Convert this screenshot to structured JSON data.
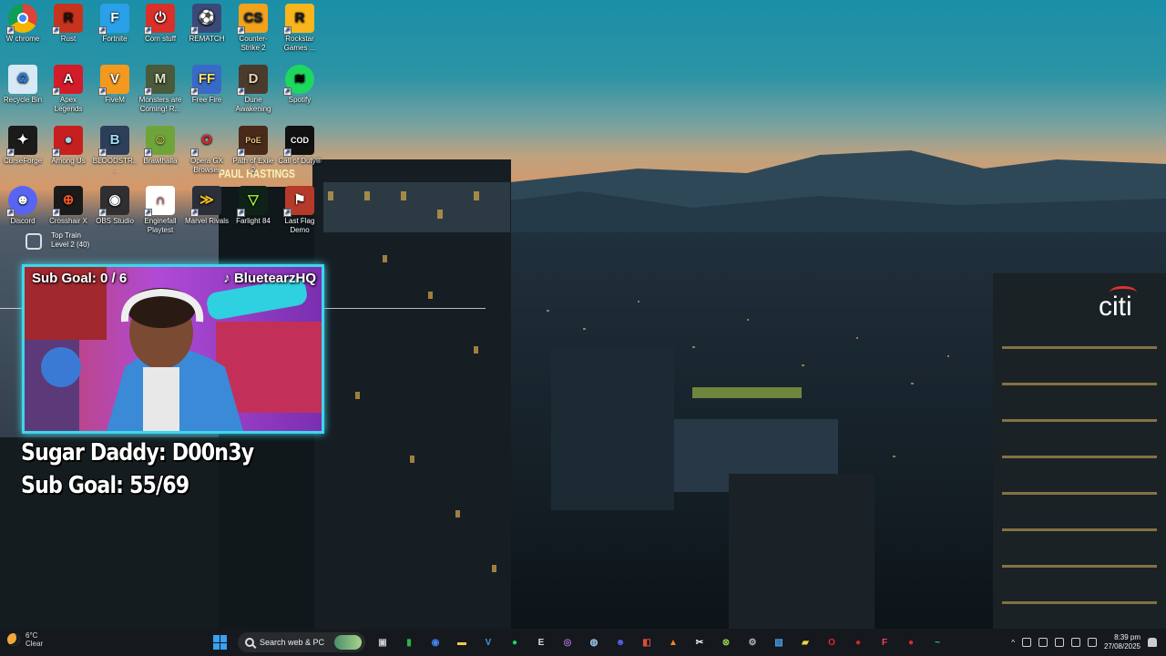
{
  "desktop": {
    "icons": [
      {
        "label": "W chrome",
        "icon": "chrome-icon",
        "glyph": "",
        "bg": "#ffffff",
        "fg": "#db4437"
      },
      {
        "label": "Rust",
        "icon": "rust-icon",
        "glyph": "R",
        "bg": "#c8331e",
        "fg": "#2b0d08"
      },
      {
        "label": "Fortnite",
        "icon": "fortnite-icon",
        "glyph": "F",
        "bg": "#2aa0e8",
        "fg": "#ffffff"
      },
      {
        "label": "Com stuff",
        "icon": "power-icon",
        "glyph": "⏻",
        "bg": "#d9302a",
        "fg": "#ffffff"
      },
      {
        "label": "REMATCH",
        "icon": "rematch-icon",
        "glyph": "⚽",
        "bg": "#3a4a78",
        "fg": "#ffffff"
      },
      {
        "label": "Counter-Strike 2",
        "icon": "counter-strike-icon",
        "glyph": "CS",
        "bg": "#f3a21c",
        "fg": "#1b2738"
      },
      {
        "label": "Rockstar Games ...",
        "icon": "rockstar-icon",
        "glyph": "R",
        "bg": "#f8b61c",
        "fg": "#1a1a1a"
      },
      {
        "label": "Recycle Bin",
        "icon": "recycle-bin-icon",
        "glyph": "♻",
        "bg": "#d7e9f5",
        "fg": "#2a7bd4"
      },
      {
        "label": "Apex Legends",
        "icon": "apex-icon",
        "glyph": "A",
        "bg": "#d21c2a",
        "fg": "#ffffff"
      },
      {
        "label": "FiveM",
        "icon": "fivem-icon",
        "glyph": "V",
        "bg": "#f39a1e",
        "fg": "#ffffff"
      },
      {
        "label": "Monsters are Coming! R...",
        "icon": "monsters-icon",
        "glyph": "M",
        "bg": "#4a5a3a",
        "fg": "#dfe3c0"
      },
      {
        "label": "Free Fire",
        "icon": "free-fire-icon",
        "glyph": "FF",
        "bg": "#3a6ac8",
        "fg": "#ffe16a"
      },
      {
        "label": "Dune Awakening",
        "icon": "dune-icon",
        "glyph": "D",
        "bg": "#4a3b2d",
        "fg": "#e8d6b5"
      },
      {
        "label": "Spotify",
        "icon": "spotify-icon",
        "glyph": "≋",
        "bg": "#1ed760",
        "fg": "#000000"
      },
      {
        "label": "CurseForge",
        "icon": "curseforge-icon",
        "glyph": "✦",
        "bg": "#1b1b1b",
        "fg": "#ffffff"
      },
      {
        "label": "Among Us",
        "icon": "among-us-icon",
        "glyph": "●",
        "bg": "#c71f1f",
        "fg": "#9fd7f2"
      },
      {
        "label": "BLOODSTR...",
        "icon": "bloodstrike-icon",
        "glyph": "B",
        "bg": "#2d3e5a",
        "fg": "#9fe0f5"
      },
      {
        "label": "Brawlhalla",
        "icon": "brawlhalla-icon",
        "glyph": "☺",
        "bg": "#6ea43a",
        "fg": "#ffe16a"
      },
      {
        "label": "Opera GX Browser",
        "icon": "opera-gx-icon",
        "glyph": "O",
        "bg": "transparent",
        "fg": "#e8242e"
      },
      {
        "label": "Path of Exile 2",
        "icon": "path-of-exile-icon",
        "glyph": "PoE",
        "bg": "#4a2a1a",
        "fg": "#e7c37a"
      },
      {
        "label": "Call of Duty®",
        "icon": "call-of-duty-icon",
        "glyph": "COD",
        "bg": "#111111",
        "fg": "#ffffff"
      },
      {
        "label": "Discord",
        "icon": "discord-icon",
        "glyph": "☻",
        "bg": "#5865f2",
        "fg": "#ffffff"
      },
      {
        "label": "Crosshair X",
        "icon": "crosshair-icon",
        "glyph": "⊕",
        "bg": "#1a1a1a",
        "fg": "#f0582a"
      },
      {
        "label": "OBS Studio",
        "icon": "obs-icon",
        "glyph": "◉",
        "bg": "#302e31",
        "fg": "#ffffff"
      },
      {
        "label": "Enginefall Playtest",
        "icon": "enginefall-icon",
        "glyph": "∩",
        "bg": "#ffffff",
        "fg": "#d2232a"
      },
      {
        "label": "Marvel Rivals",
        "icon": "marvel-rivals-icon",
        "glyph": "≫",
        "bg": "#2a2f3a",
        "fg": "#f6c324"
      },
      {
        "label": "Farlight 84",
        "icon": "farlight-icon",
        "glyph": "▽",
        "bg": "#0e2218",
        "fg": "#a6f23a"
      },
      {
        "label": "Last Flag Demo",
        "icon": "last-flag-icon",
        "glyph": "⚑",
        "bg": "#b63a2a",
        "fg": "#ffffff"
      }
    ],
    "extra_item": {
      "line1": "Top Train",
      "line2": "Level 2 (40)"
    }
  },
  "stream_overlay": {
    "cam_goal": "Sub Goal: 0 / 6",
    "cam_handle": "♪ BluetearzHQ",
    "sugar_daddy": "Sugar Daddy: D00n3y",
    "sub_goal": "Sub Goal: 55/69"
  },
  "wallpaper": {
    "sign": "PAUL HASTINGS",
    "citi": "citi"
  },
  "taskbar": {
    "weather_line1": "6°C",
    "weather_line2": "Clear",
    "search_placeholder": "Search web & PC",
    "apps": [
      {
        "name": "task-view-icon",
        "glyph": "▣",
        "color": "#cccccc"
      },
      {
        "name": "xbox-app-icon",
        "glyph": "▮",
        "color": "#2bb24a"
      },
      {
        "name": "chrome-taskbar-icon",
        "glyph": "◉",
        "color": "#4285f4"
      },
      {
        "name": "file-explorer-icon",
        "glyph": "▬",
        "color": "#f7c948"
      },
      {
        "name": "visual-studio-icon",
        "glyph": "V",
        "color": "#3a9ad9"
      },
      {
        "name": "spotify-taskbar-icon",
        "glyph": "●",
        "color": "#1ed760"
      },
      {
        "name": "epic-games-icon",
        "glyph": "E",
        "color": "#dddddd"
      },
      {
        "name": "obs-taskbar-icon",
        "glyph": "◎",
        "color": "#b06cd0"
      },
      {
        "name": "steam-icon",
        "glyph": "◍",
        "color": "#9ec7e6"
      },
      {
        "name": "discord-taskbar-icon",
        "glyph": "☻",
        "color": "#5865f2"
      },
      {
        "name": "office-icon",
        "glyph": "◧",
        "color": "#e04b3a"
      },
      {
        "name": "vlc-icon",
        "glyph": "▲",
        "color": "#f08a1a"
      },
      {
        "name": "capcut-icon",
        "glyph": "✂",
        "color": "#ffffff"
      },
      {
        "name": "xbox-icon",
        "glyph": "⊗",
        "color": "#9ad24a"
      },
      {
        "name": "settings-icon",
        "glyph": "⚙",
        "color": "#bbbbbb"
      },
      {
        "name": "photos-icon",
        "glyph": "▧",
        "color": "#4aa3e8"
      },
      {
        "name": "sticky-notes-icon",
        "glyph": "▰",
        "color": "#f5d442"
      },
      {
        "name": "opera-icon",
        "glyph": "O",
        "color": "#e8242e"
      },
      {
        "name": "among-us-taskbar-icon",
        "glyph": "●",
        "color": "#d02a2a"
      },
      {
        "name": "tiktok-icon",
        "glyph": "F",
        "color": "#ff3b5c"
      },
      {
        "name": "record-icon",
        "glyph": "●",
        "color": "#d62d2d"
      },
      {
        "name": "terminal-icon",
        "glyph": "~",
        "color": "#2ec48a"
      }
    ],
    "time": "8:39 pm",
    "date": "27/08/2025"
  }
}
